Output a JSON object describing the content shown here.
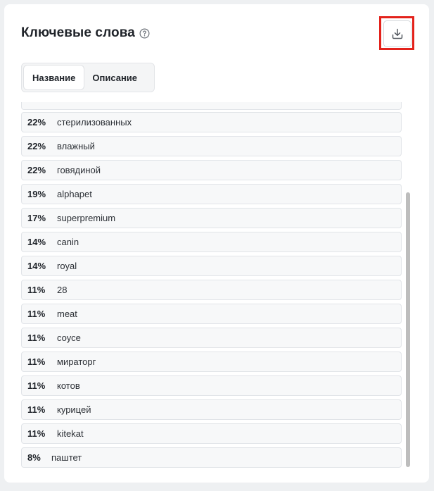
{
  "header": {
    "title": "Ключевые слова",
    "help_icon": "question-circle-icon",
    "download_icon": "download-icon"
  },
  "tabs": [
    {
      "label": "Название",
      "active": true
    },
    {
      "label": "Описание",
      "active": false
    }
  ],
  "keywords": [
    {
      "percent": "22%",
      "word": "стерилизованных"
    },
    {
      "percent": "22%",
      "word": "влажный"
    },
    {
      "percent": "22%",
      "word": "говядиной"
    },
    {
      "percent": "19%",
      "word": "alphapet"
    },
    {
      "percent": "17%",
      "word": "superpremium"
    },
    {
      "percent": "14%",
      "word": "canin"
    },
    {
      "percent": "14%",
      "word": "royal"
    },
    {
      "percent": "11%",
      "word": "28"
    },
    {
      "percent": "11%",
      "word": "meat"
    },
    {
      "percent": "11%",
      "word": "соусе"
    },
    {
      "percent": "11%",
      "word": "мираторг"
    },
    {
      "percent": "11%",
      "word": "котов"
    },
    {
      "percent": "11%",
      "word": "курицей"
    },
    {
      "percent": "11%",
      "word": "kitekat"
    },
    {
      "percent": "8%",
      "word": "паштет"
    }
  ],
  "colors": {
    "highlight": "#e3221b",
    "scrollbar": "#bdbdbd"
  }
}
